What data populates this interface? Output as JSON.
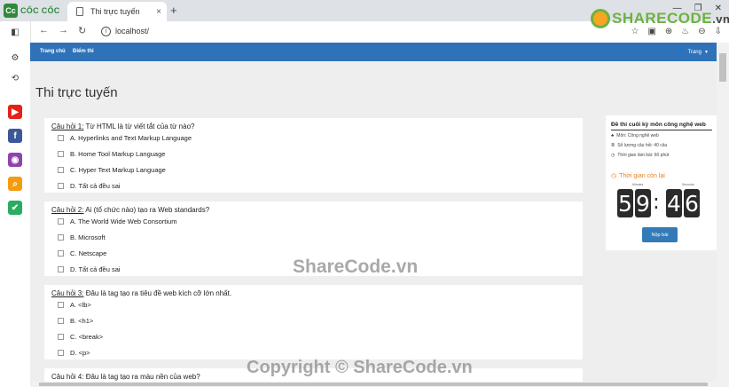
{
  "browser": {
    "logo_badge": "Cc",
    "logo_text": "CỐC CỐC",
    "tab_title": "Thi trực tuyến",
    "tab_close": "×",
    "new_tab": "+",
    "url": "localhost/",
    "controls": {
      "minimize": "—",
      "restore": "❐",
      "close": "✕"
    },
    "nav": {
      "back": "←",
      "forward": "→",
      "reload": "↻",
      "info": "i"
    },
    "toolbar_icons": [
      "☆",
      "▣",
      "⊕",
      "♨",
      "⊖",
      "⇩"
    ]
  },
  "brand": {
    "name": "SHARECODE",
    "suffix": ".vn"
  },
  "sidebar": {
    "icons": [
      "sidebar-toggle-icon",
      "settings-icon",
      "history-icon",
      "youtube-icon",
      "facebook-icon",
      "messenger-icon",
      "search-icon",
      "coccoc-icon"
    ],
    "glyphs": [
      "◧",
      "⚙",
      "⟲",
      "▶",
      "f",
      "◉",
      "⌕",
      "✔"
    ],
    "colors": {
      "youtube": "#e62117",
      "facebook": "#3b5998",
      "messenger": "#8e44ad",
      "search": "#f39c12",
      "coccoc": "#27ae60"
    }
  },
  "navbar": {
    "links": [
      "Trang chủ",
      "Điểm thi"
    ],
    "user_label": "Trang",
    "user_icon": "👤",
    "caret": "▾",
    "color": "#2f72b8"
  },
  "page_title": "Thi trực tuyến",
  "questions": [
    {
      "label": "Câu hỏi 1:",
      "text": " Từ HTML là từ viết tắt của từ nào?",
      "options": [
        "A. Hyperlinks and Text Markup Language",
        "B. Home Tool Markup Language",
        "C. Hyper Text Markup Language",
        "D. Tất cả đều sai"
      ]
    },
    {
      "label": "Câu hỏi 2:",
      "text": " Ai (tổ chức nào) tạo ra Web standards?",
      "options": [
        "A. The World Wide Web Consortium",
        "B. Microsoft",
        "C. Netscape",
        "D. Tất cả đều sai"
      ]
    },
    {
      "label": "Câu hỏi 3:",
      "text": " Đâu là tag tạo ra tiêu đề web kích cỡ lớn nhất.",
      "options": [
        "A. <lb>",
        "B. <h1>",
        "C. <break>",
        "D. <p>"
      ]
    },
    {
      "label": "Câu hỏi 4:",
      "text": " Đâu là tag tạo ra màu nền của web?",
      "options": []
    }
  ],
  "exam": {
    "title": "Đề thi cuối kỳ môn công nghệ web",
    "subject": "Môn: Công nghệ web",
    "count": "Số lượng câu hỏi: 40 câu",
    "time": "Thời gian làm bài: 60 phút",
    "timer_label": "Thời gian còn lại",
    "minutes_label": "Minutes",
    "seconds_label": "Seconds",
    "digits": [
      "5",
      "9",
      "4",
      "6"
    ],
    "separator": ":",
    "submit": "Nộp bài",
    "icons": {
      "subject": "♣",
      "count": "≣",
      "time": "◷",
      "timer": "◷"
    }
  },
  "watermarks": {
    "center": "ShareCode.vn",
    "bottom": "Copyright © ShareCode.vn"
  }
}
